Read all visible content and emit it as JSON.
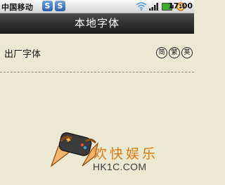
{
  "status_bar": {
    "carrier": "中国移动",
    "app_icon_1": "S",
    "app_icon_2": "S",
    "time": "17:00"
  },
  "title_bar": {
    "title": "本地字体"
  },
  "font_list": {
    "items": [
      {
        "label": "出厂字体",
        "badges": [
          "简",
          "繁",
          "英"
        ]
      }
    ]
  },
  "watermark": {
    "cn": "欢快娱乐",
    "en": "HK1C.COM"
  }
}
